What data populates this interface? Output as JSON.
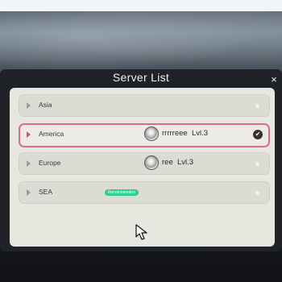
{
  "dialog": {
    "title": "Server List",
    "close_label": "×"
  },
  "servers": [
    {
      "name": "Asia",
      "selected": false,
      "character": null,
      "badge": ""
    },
    {
      "name": "America",
      "selected": true,
      "character": {
        "name": "rrrrreee",
        "level": "Lvl.3"
      },
      "badge": ""
    },
    {
      "name": "Europe",
      "selected": false,
      "character": {
        "name": "ree",
        "level": "Lvl.3"
      },
      "badge": ""
    },
    {
      "name": "SEA",
      "selected": false,
      "character": null,
      "badge": "Recommended"
    }
  ],
  "colors": {
    "selected_border": "#e06a8a",
    "badge": "#2fcf8a",
    "panel": "#e7e6df",
    "dialog": "#1f2226"
  }
}
